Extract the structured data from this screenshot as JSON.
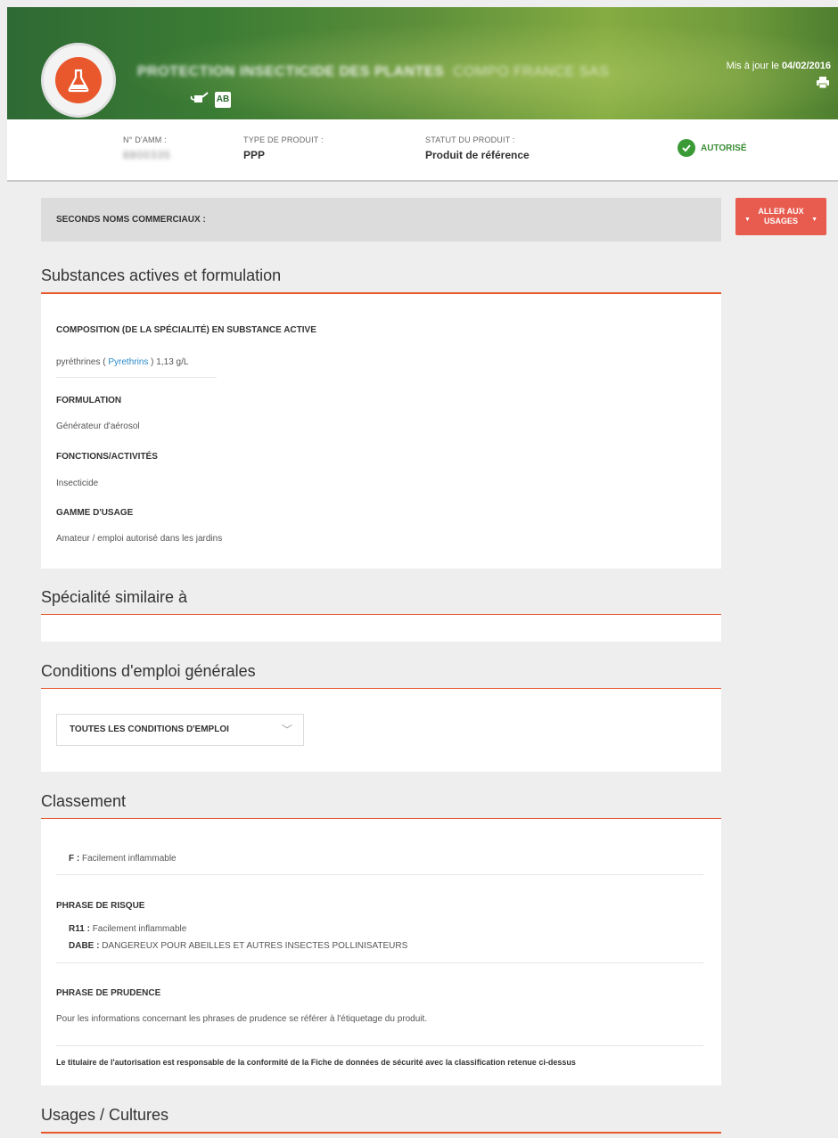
{
  "header": {
    "product_name": "PROTECTION INSECTICIDE DES PLANTES",
    "company": "COMPO FRANCE SAS",
    "ab_badge": "AB",
    "update_prefix": "Mis à jour le",
    "update_date": "04/02/2016"
  },
  "info": {
    "amm_label": "N° D'AMM :",
    "amm_value": "8800335",
    "type_label": "TYPE DE PRODUIT :",
    "type_value": "PPP",
    "statut_label": "STATUT DU PRODUIT :",
    "statut_value": "Produit de référence",
    "status_badge": "AUTORISÉ"
  },
  "seconds_label": "SECONDS NOMS COMMERCIAUX :",
  "goto_button": {
    "line1": "ALLER AUX",
    "line2": "USAGES"
  },
  "substances": {
    "title": "Substances actives et formulation",
    "composition_heading": "COMPOSITION (DE LA SPÉCIALITÉ) EN SUBSTANCE ACTIVE",
    "substance_name": "pyréthrines",
    "substance_open": "(",
    "substance_link": "Pyrethrins",
    "substance_close": ")",
    "substance_amount": "1,13 g/L",
    "formulation_heading": "FORMULATION",
    "formulation_value": "Générateur d'aérosol",
    "fonctions_heading": "FONCTIONS/ACTIVITÉS",
    "fonctions_value": "Insecticide",
    "gamme_heading": "GAMME D'USAGE",
    "gamme_value": "Amateur / emploi autorisé dans les jardins"
  },
  "similaire": {
    "title": "Spécialité similaire à"
  },
  "conditions": {
    "title": "Conditions d'emploi générales",
    "dropdown_value": "TOUTES LES CONDITIONS D'EMPLOI"
  },
  "classement": {
    "title": "Classement",
    "class_code": "F :",
    "class_text": "Facilement inflammable",
    "risque_heading": "PHRASE DE RISQUE",
    "risques": [
      {
        "code": "R11 :",
        "text": "Facilement inflammable"
      },
      {
        "code": "DABE :",
        "text": "DANGEREUX POUR ABEILLES ET AUTRES INSECTES POLLINISATEURS"
      }
    ],
    "prudence_heading": "PHRASE DE PRUDENCE",
    "prudence_text": "Pour les informations concernant les phrases de prudence se référer à l'étiquetage du produit.",
    "footer_note": "Le titulaire de l'autorisation est responsable de la conformité de la Fiche de données de sécurité avec la classification retenue ci-dessus"
  },
  "usages": {
    "title": "Usages / Cultures"
  },
  "colors": {
    "accent": "#e8582c",
    "status_green": "#3a9a36",
    "button_red": "#e85c50",
    "link_blue": "#2b8ac9"
  },
  "icons": [
    "flask-icon",
    "watering-can-icon",
    "ab-badge-icon",
    "print-icon",
    "check-circle-icon",
    "chevron-down-icon",
    "caret-down-icon"
  ]
}
